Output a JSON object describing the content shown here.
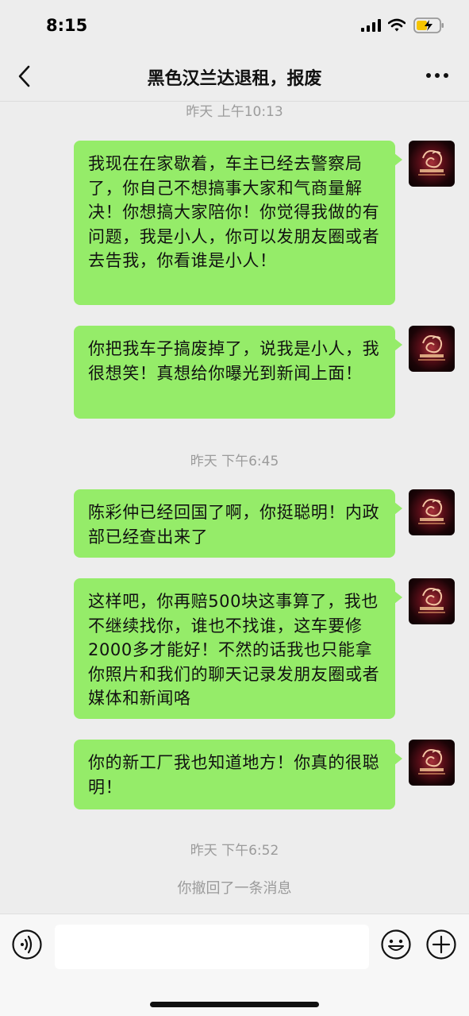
{
  "status_bar": {
    "time": "8:15"
  },
  "nav": {
    "title": "黑色汉兰达退租，报废"
  },
  "chat": {
    "timestamps": [
      "昨天 上午10:13",
      "昨天 下午6:45",
      "昨天 下午6:52"
    ],
    "messages": [
      {
        "text": "我现在在家歇着，车主已经去警察局了，你自己不想搞事大家和气商量解决！你想搞大家陪你！你觉得我做的有问题，我是小人，你可以发朋友圈或者去告我，你看谁是小人！"
      },
      {
        "text": "你把我车子搞废掉了，说我是小人，我很想笑！真想给你曝光到新闻上面！"
      },
      {
        "text": "陈彩仲已经回国了啊，你挺聪明！内政部已经查出来了"
      },
      {
        "text": "这样吧，你再赔500块这事算了，我也不继续找你，谁也不找谁，这车要修2000多才能好！不然的话我也只能拿你照片和我们的聊天记录发朋友圈或者媒体和新闻咯"
      },
      {
        "text": "你的新工厂我也知道地方！你真的很聪明！"
      }
    ],
    "recall_notice": "你撤回了一条消息"
  },
  "input_bar": {
    "placeholder": ""
  },
  "colors": {
    "bubble": "#95ec69",
    "background": "#ededed",
    "meta_text": "#9b9b9b"
  }
}
